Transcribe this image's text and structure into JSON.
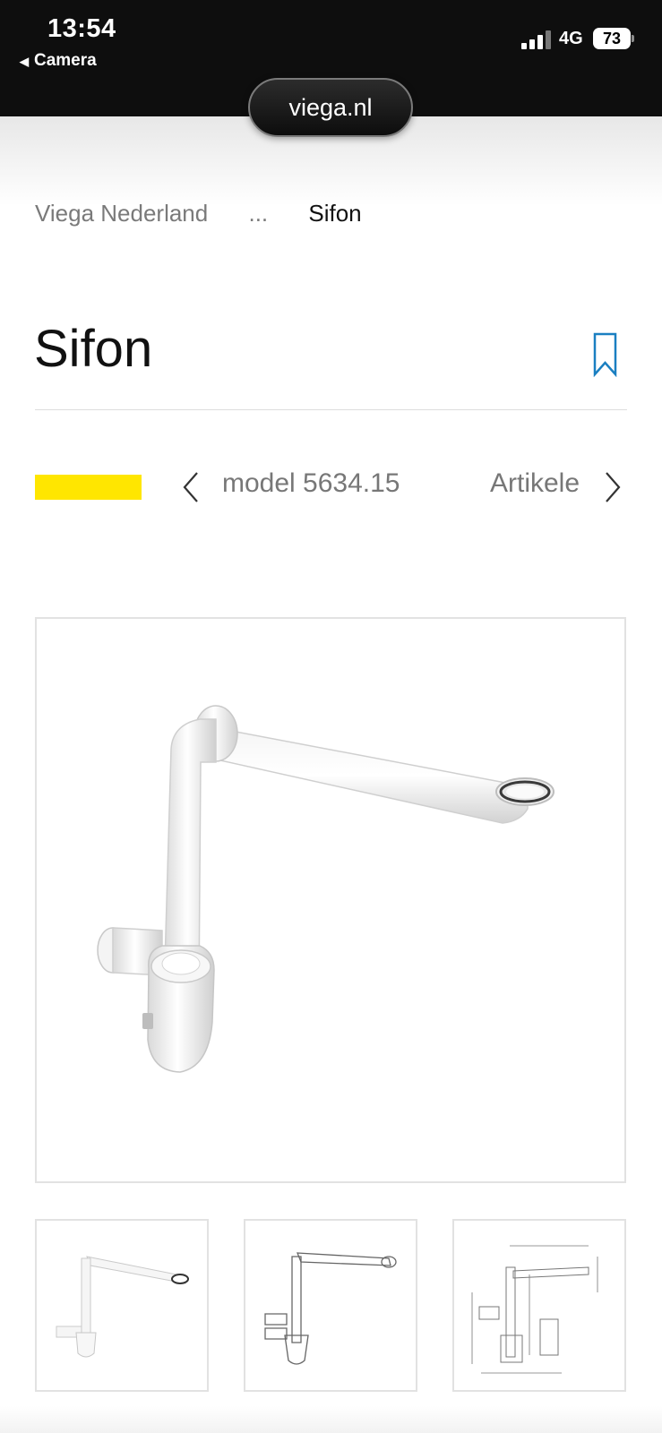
{
  "status_bar": {
    "time": "13:54",
    "back_label": "Camera",
    "network": "4G",
    "battery": "73",
    "signal_icon": "signal-bars-icon",
    "back_icon": "back-triangle-icon"
  },
  "browser": {
    "url": "viega.nl"
  },
  "breadcrumb": {
    "home": "Viega Nederland",
    "ellipsis": "...",
    "current": "Sifon"
  },
  "page": {
    "title": "Sifon",
    "bookmark_icon": "bookmark-icon"
  },
  "tabs": {
    "items": [
      {
        "label": "model 5634.15"
      },
      {
        "label": "Artikele"
      }
    ],
    "prev_icon": "chevron-left-icon",
    "next_icon": "chevron-right-icon"
  },
  "gallery": {
    "thumb_count": 3
  },
  "colors": {
    "accent_yellow": "#ffe600",
    "link_blue": "#1a7fc1",
    "status_bar_bg": "#0e0e0e"
  }
}
